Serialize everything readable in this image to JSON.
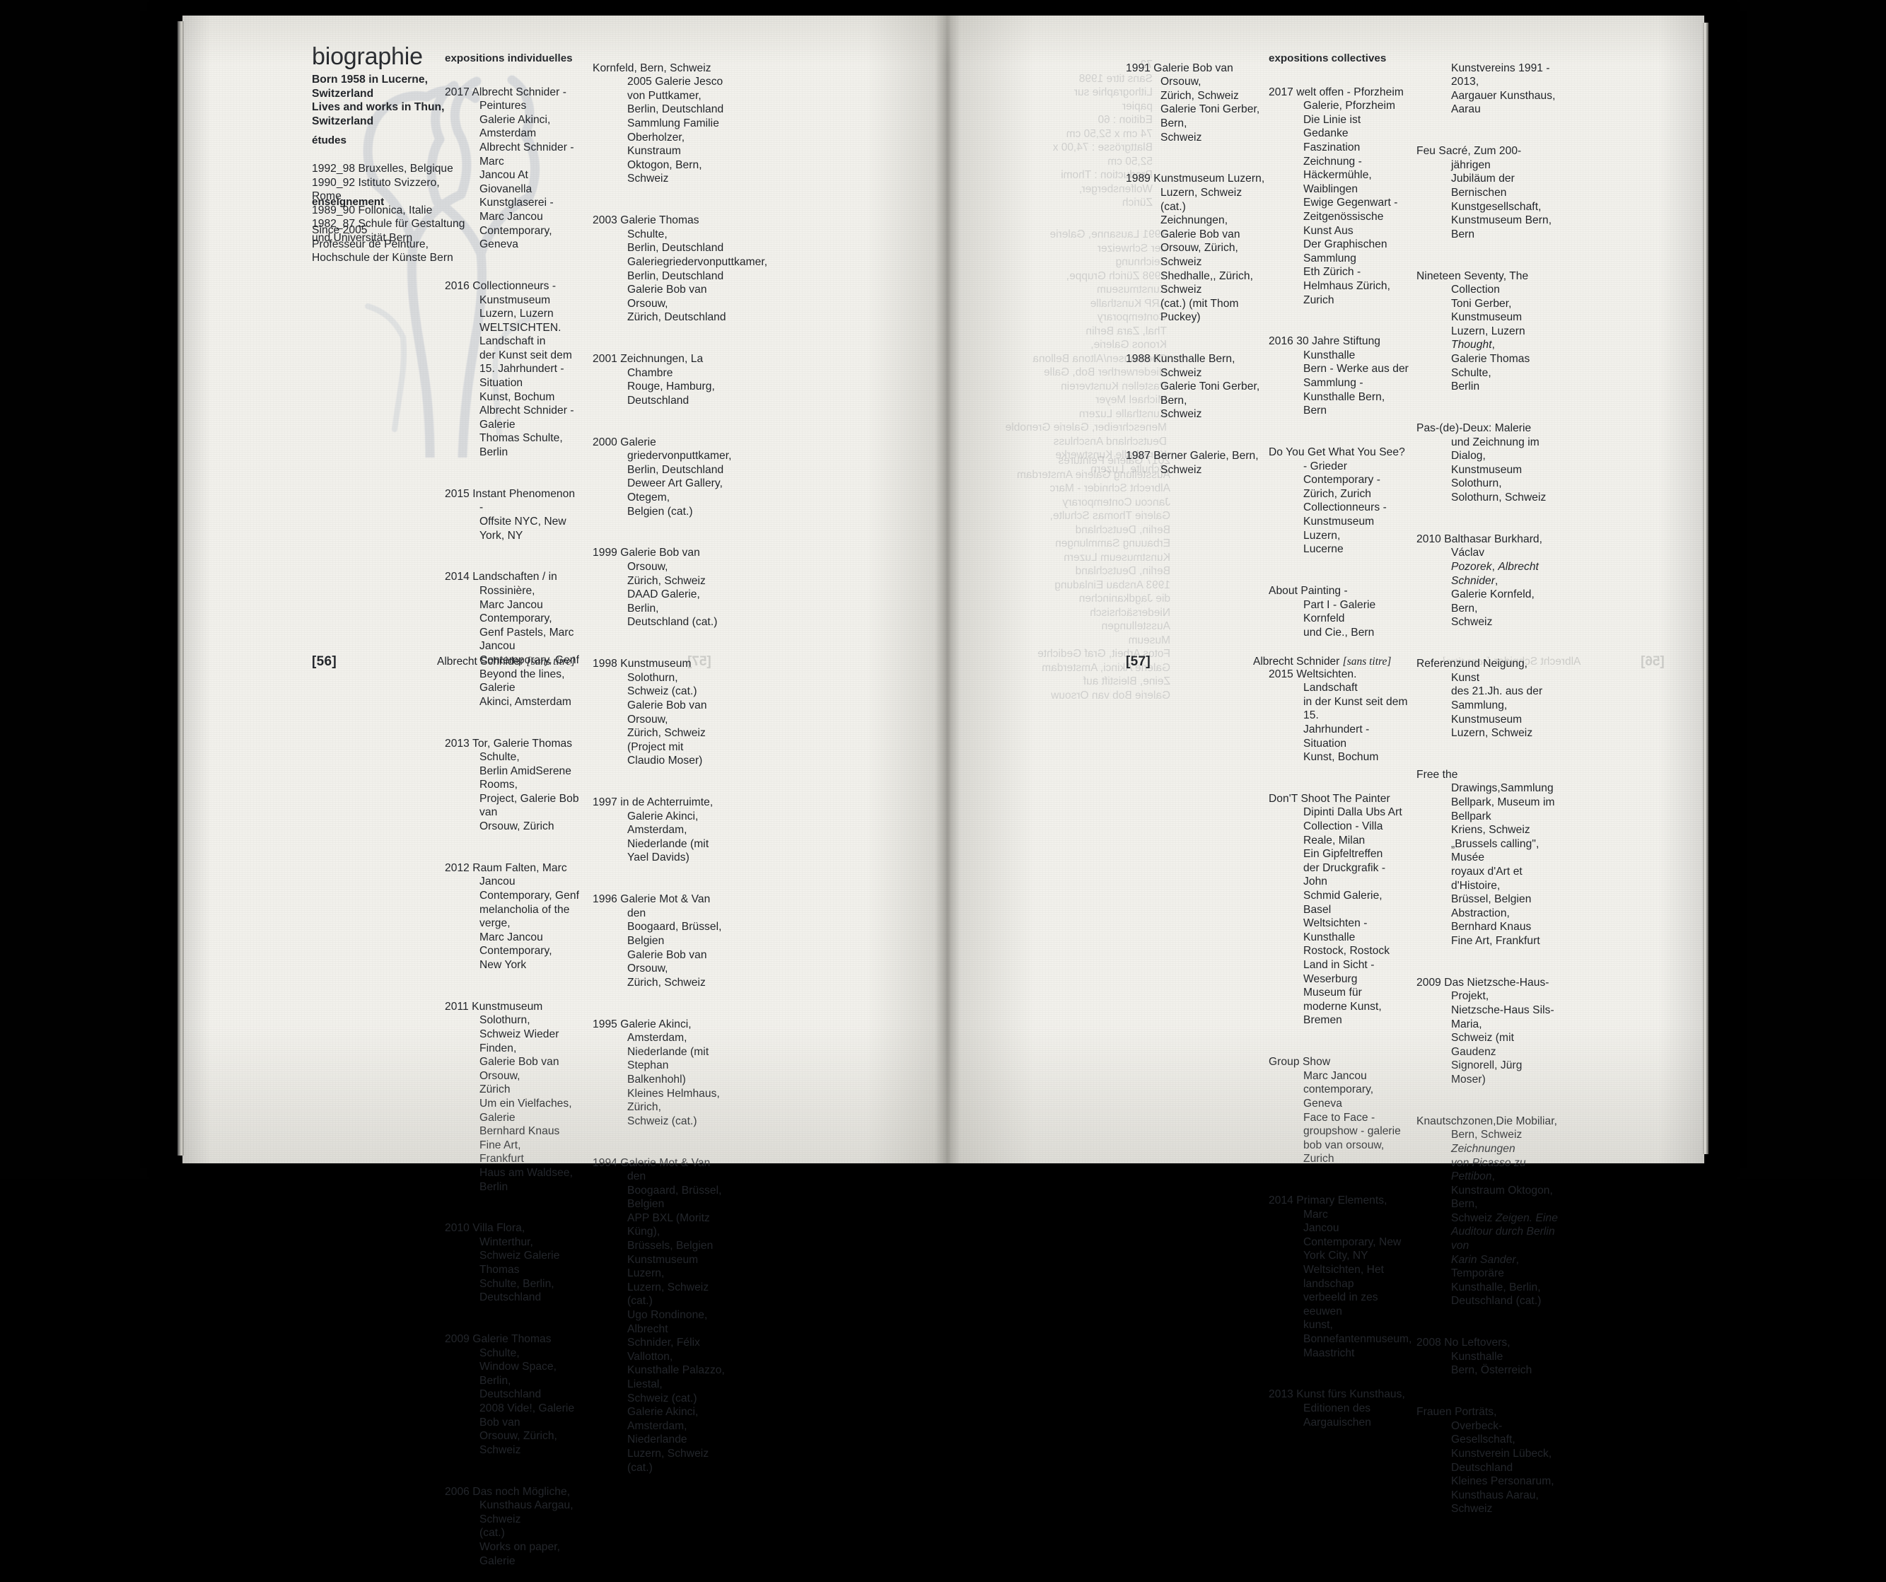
{
  "spread": {
    "left_page": {
      "title": "biographie",
      "intro": "Born 1958 in Lucerne,\nSwitzerland\nLives and works in Thun,\nSwitzerland",
      "sections": [
        {
          "heading": "études",
          "body": "1992_98 Bruxelles, Belgique\n1990_92 Istituto Svizzero, Rome\n1989_90 Follonica, Italie\n1982_87 Schule für Gestaltung\n            und Universität Bern"
        },
        {
          "heading": "enseignement",
          "body": "Since 2005\nProfesseur de Peinture,\nHochschule der Künste Bern"
        }
      ],
      "column_heading": "expositions individuelles",
      "column_b_entries": [
        "2017 Albrecht Schnider -Peintures\nGalerie Akinci, Amsterdam\nAlbrecht Schnider - Marc\nJancou At Giovanella\nKunstglaserei - Marc Jancou\nContemporary, Geneva",
        "2016 Collectionneurs -\nKunstmuseum Luzern, Luzern\nWELTSICHTEN. Landschaft in\nder Kunst seit dem\n15. Jahrhundert - Situation\nKunst, Bochum\nAlbrecht Schnider - Galerie\nThomas Schulte, Berlin",
        "2015 Instant Phenomenon -\nOffsite NYC, New York, NY",
        "2014 Landschaften / in Rossinière,\nMarc Jancou Contemporary,\nGenf Pastels, Marc Jancou\nContemporary, Genf\nBeyond the lines, Galerie\nAkinci, Amsterdam",
        "2013 Tor, Galerie Thomas Schulte,\nBerlin AmidSerene Rooms,\nProject, Galerie Bob van\nOrsouw, Zürich",
        "2012 Raum Falten, Marc Jancou\nContemporary, Genf\nmelancholia of the verge,\nMarc Jancou Contemporary,\nNew York",
        "2011 Kunstmuseum Solothurn,\nSchweiz Wieder Finden,\nGalerie Bob van Orsouw,\nZürich\nUm ein Vielfaches, Galerie\nBernhard Knaus Fine Art,\nFrankfurt\nHaus am Waldsee, Berlin",
        "2010 Villa Flora, Winterthur,\nSchweiz Galerie Thomas\nSchulte, Berlin, Deutschland",
        "2009 Galerie Thomas Schulte,\nWindow Space, Berlin,\nDeutschland\n2008 Vide!, Galerie Bob van\nOrsouw, Zürich, Schweiz",
        "2006 Das noch Mögliche,\nKunsthaus Aargau, Schweiz\n(cat.)\nWorks on paper, Galerie"
      ],
      "column_c_entries": [
        "Kornfeld, Bern, Schweiz\n2005 Galerie Jesco von Puttkamer,\nBerlin, Deutschland\nSammlung Familie\nOberholzer, Kunstraum\nOktogon, Bern, Schweiz",
        "2003 Galerie Thomas Schulte,\nBerlin, Deutschland\nGaleriegriedervonputtkamer,\nBerlin, Deutschland\nGalerie Bob van Orsouw,\nZürich, Deutschland",
        "2001 Zeichnungen, La Chambre\nRouge, Hamburg,\nDeutschland",
        "2000 Galerie griedervonputtkamer,\nBerlin, Deutschland\nDeweer Art Gallery, Otegem,\nBelgien (cat.)",
        "1999 Galerie Bob van Orsouw,\nZürich, Schweiz\nDAAD Galerie, Berlin,\nDeutschland (cat.)",
        "1998 Kunstmuseum Solothurn,\nSchweiz (cat.)\nGalerie Bob van Orsouw,\nZürich, Schweiz (Project mit\nClaudio Moser)",
        "1997 in de Achterruimte,\nGalerie Akinci, Amsterdam,\nNiederlande (mit Yael Davids)",
        "1996 Galerie Mot & Van den\nBoogaard, Brüssel, Belgien\nGalerie Bob van Orsouw,\nZürich, Schweiz",
        "1995 Galerie Akinci, Amsterdam,\nNiederlande (mit Stephan\nBalkenhohl)\nKleines Helmhaus, Zürich,\nSchweiz (cat.)",
        "1994 Galerie Mot & Van den\nBoogaard, Brüssel, Belgien\nAPP BXL (Moritz Küng),\nBrüssels, Belgien\nKunstmuseum Luzern,\nLuzern, Schweiz (cat.)\nUgo Rondinone, Albrecht\nSchnider, Félix Vallotton,\nKunsthalle Palazzo, Liestal,\nSchweiz (cat.)\nGalerie Akinci, Amsterdam,\nNiederlande\nLuzern, Schweiz (cat.)"
      ],
      "folio": "[56]",
      "running_head_name": "Albrecht Schnider ",
      "running_head_title": "[sans titre]"
    },
    "right_page": {
      "column_a_entries": [
        "1991 Galerie Bob van Orsouw,\nZürich, Schweiz\nGalerie Toni Gerber, Bern,\nSchweiz",
        "1989 Kunstmuseum Luzern,\nLuzern, Schweiz (cat.)\nZeichnungen, Galerie Bob van\nOrsouw, Zürich, Schweiz\nShedhalle,, Zürich, Schweiz\n(cat.) (mit Thom Puckey)",
        "1988 Kunsthalle Bern, Schweiz\nGalerie Toni Gerber, Bern,\nSchweiz",
        "1987 Berner Galerie, Bern,\nSchweiz"
      ],
      "column_heading": "expositions collectives",
      "column_b_entries": [
        "2017 welt offen - Pforzheim\nGalerie, Pforzheim\nDie Linie ist Gedanke\nFaszination Zeichnung -\nHäckermühle, Waiblingen\nEwige Gegenwart -\nZeitgenössische Kunst Aus\nDer Graphischen Sammlung\nEth Zürich - Helmhaus Zürich,\nZurich",
        "2016 30 Jahre Stiftung Kunsthalle\nBern - Werke aus der\nSammlung - Kunsthalle Bern,\nBern",
        "Do You Get What You See?\n- Grieder Contemporary -\nZürich, Zurich\nCollectionneurs -\nKunstmuseum Luzern,\nLucerne",
        "About Painting -\nPart I - Galerie Kornfeld\nund Cie., Bern",
        "2015 Weltsichten. Landschaft\nin der Kunst seit dem 15.\nJahrhundert - Situation\nKunst, Bochum",
        "Don'T Shoot The Painter\nDipinti Dalla Ubs Art\nCollection - Villa Reale, Milan\nEin Gipfeltreffen\nder Druckgrafik - John\nSchmid Galerie, Basel\nWeltsichten - Kunsthalle\nRostock, Rostock\nLand in Sicht - Weserburg\nMuseum für moderne Kunst,\nBremen",
        "Group Show\nMarc Jancou contemporary,\nGeneva\nFace to Face - groupshow - galerie\nbob van orsouw, Zurich",
        "2014 Primary Elements, Marc\nJancou Contemporary, New\nYork City, NY\nWeltsichten, Het landschap\nverbeeld in zes eeuwen\nkunst, Bonnefantenmuseum,\nMaastricht",
        "2013 Kunst fürs Kunsthaus,\nEditionen des Aargauischen"
      ],
      "column_c_entries": [
        "Kunstvereins 1991 - 2013,\nAargauer Kunsthaus, Aarau",
        "Feu Sacré, Zum 200-jährigen\nJubiläum der Bernischen\nKunstgesellschaft,\nKunstmuseum Bern, Bern",
        "Nineteen Seventy, The Collection\nToni Gerber, Kunstmuseum\nLuzern, Luzern |Thought|,\nGalerie Thomas Schulte,\nBerlin",
        "Pas-(de)-Deux: Malerie\nund Zeichnung im Dialog,\nKunstmuseum Solothurn,\nSolothurn, Schweiz",
        "2010 Balthasar Burkhard, Václav\n|Pozorek|, |Albrecht Schnider|,\nGalerie Kornfeld, Bern,\nSchweiz",
        "Referenzund Neigung, Kunst\ndes 21.Jh. aus der\nSammlung, Kunstmuseum\nLuzern, Schweiz",
        "Free the Drawings,Sammlung\nBellpark, Museum im Bellpark\nKriens, Schweiz\n„Brussels calling\", Musée\nroyaux d'Art et d'Histoire,\nBrüssel, Belgien\nAbstraction, Bernhard Knaus\nFine Art, Frankfurt",
        "2009 Das Nietzsche-Haus-Projekt,\nNietzsche-Haus Sils-Maria,\nSchweiz (mit Gaudenz\nSignorell, Jürg Moser)",
        "Knautschzonen,Die Mobiliar,\nBern, Schweiz |Zeichnungen|\n|von Picasso zu Pettibon|,\nKunstraum Oktogon, Bern,\nSchweiz |Zeigen. Eine|\n|Auditour durch Berlin von|\n|Karin Sander|, Temporäre\nKunsthalle, Berlin,\nDeutschland (cat.)",
        "2008 No Leftovers, Kunsthalle\nBern, Österreich",
        "Frauen Porträts,\nOverbeck-Gesellschaft,\nKunstverein Lübeck,\nDeutschland\nKleines Personarum,\nKunsthaus Aarau, Schweiz"
      ],
      "folio": "[57]",
      "running_head_name": "Albrecht Schnider ",
      "running_head_title": "[sans titre]"
    }
  },
  "colors": {
    "paper": "#f2f1ec",
    "ink": "#23262b",
    "backdrop": "#000000",
    "ghost_illustration": "#aab4c6"
  }
}
